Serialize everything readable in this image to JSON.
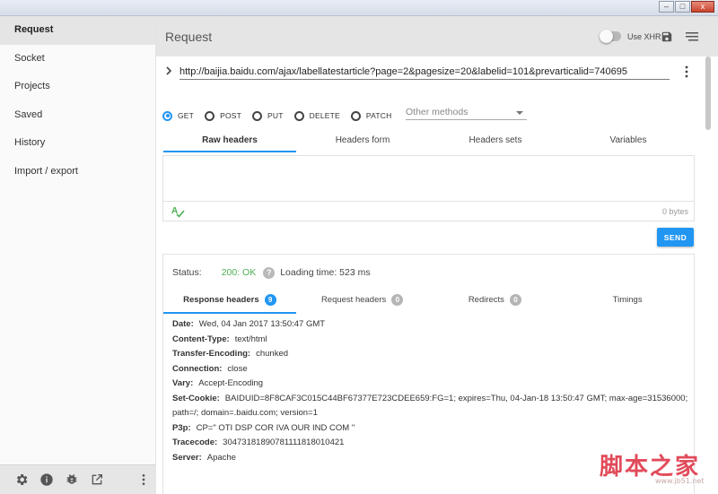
{
  "window": {
    "menu": [
      "",
      "",
      "",
      "",
      ""
    ],
    "controls": {
      "minimize": "–",
      "maximize": "□",
      "close": "x"
    }
  },
  "sidebar": {
    "items": [
      {
        "label": "Request",
        "active": true
      },
      {
        "label": "Socket"
      },
      {
        "label": "Projects"
      },
      {
        "label": "Saved"
      },
      {
        "label": "History"
      },
      {
        "label": "Import / export"
      }
    ],
    "footer_icons": [
      "gear-icon",
      "info-icon",
      "bug-icon",
      "open-external-icon",
      "more-vert-icon"
    ]
  },
  "header": {
    "title": "Request",
    "xhr_label": "Use XHR",
    "xhr_enabled": false
  },
  "request": {
    "url": "http://baijia.baidu.com/ajax/labellatestarticle?page=2&pagesize=20&labelid=101&prevarticalid=740695",
    "methods": [
      "GET",
      "POST",
      "PUT",
      "DELETE",
      "PATCH"
    ],
    "selected_method": "GET",
    "other_methods_placeholder": "Other methods",
    "tabs": [
      "Raw headers",
      "Headers form",
      "Headers sets",
      "Variables"
    ],
    "active_tab": "Raw headers",
    "headers_size": "0 bytes",
    "send_label": "SEND"
  },
  "response": {
    "status_label": "Status:",
    "status_value": "200: OK",
    "help": "?",
    "loading_time": "Loading time: 523 ms",
    "tabs": [
      {
        "label": "Response headers",
        "badge": "9"
      },
      {
        "label": "Request headers",
        "badge": "0"
      },
      {
        "label": "Redirects",
        "badge": "0"
      },
      {
        "label": "Timings",
        "badge": ""
      }
    ],
    "headers": [
      {
        "name": "Date:",
        "value": "Wed, 04 Jan 2017 13:50:47 GMT"
      },
      {
        "name": "Content-Type:",
        "value": "text/html"
      },
      {
        "name": "Transfer-Encoding:",
        "value": "chunked"
      },
      {
        "name": "Connection:",
        "value": "close"
      },
      {
        "name": "Vary:",
        "value": "Accept-Encoding"
      },
      {
        "name": "Set-Cookie:",
        "value": "BAIDUID=8F8CAF3C015C44BF67377E723CDEE659:FG=1; expires=Thu, 04-Jan-18 13:50:47 GMT; max-age=31536000; path=/; domain=.baidu.com; version=1"
      },
      {
        "name": "P3p:",
        "value": "CP=\" OTI DSP COR IVA OUR IND COM \""
      },
      {
        "name": "Tracecode:",
        "value": "30473181890781111818010421"
      },
      {
        "name": "Server:",
        "value": "Apache"
      }
    ]
  },
  "watermark": {
    "text": "脚本之家",
    "url": "www.jb51.net"
  },
  "colors": {
    "accent": "#2196f3",
    "ok": "#4caf50",
    "header_bg": "#e5e5e5"
  }
}
